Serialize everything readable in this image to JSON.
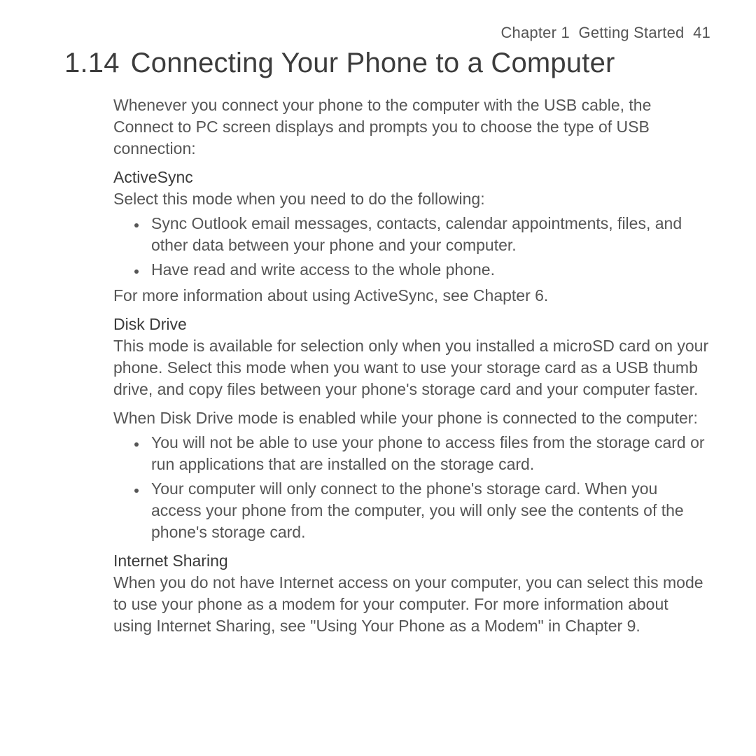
{
  "running_head": {
    "chapter": "Chapter 1",
    "title": "Getting Started",
    "page": "41"
  },
  "heading": {
    "num": "1.14",
    "title": "Connecting Your Phone to a Computer"
  },
  "intro": "Whenever you connect your phone to the computer with the USB cable, the Connect to PC screen displays and prompts you to choose the type of USB connection:",
  "sections": {
    "activesync": {
      "title": "ActiveSync",
      "lead": "Select this mode when you need to do the following:",
      "items": [
        "Sync Outlook email messages, contacts, calendar appointments, files, and other data between your phone and your computer.",
        "Have read and write access to the whole phone."
      ],
      "tail": "For more information about using ActiveSync, see Chapter 6."
    },
    "diskdrive": {
      "title": "Disk Drive",
      "lead1": "This mode is available for selection only when you installed a microSD card on your phone. Select this mode when you want to use your storage card as a USB thumb drive, and copy files between your phone's storage card and your computer faster.",
      "lead2": "When Disk Drive mode is enabled while your phone is connected to the computer:",
      "items": [
        "You will not be able to use your phone to access files from the storage card or run applications that are installed on the storage card.",
        "Your computer will only connect to the phone's storage card. When you access your phone from the computer, you will only see the contents of the phone's storage card."
      ]
    },
    "internet": {
      "title": "Internet Sharing",
      "body": "When you do not have Internet access on your computer, you can select this mode to use your phone as a modem for your computer. For more information about using Internet Sharing, see \"Using Your Phone as a Modem\" in Chapter 9."
    }
  }
}
